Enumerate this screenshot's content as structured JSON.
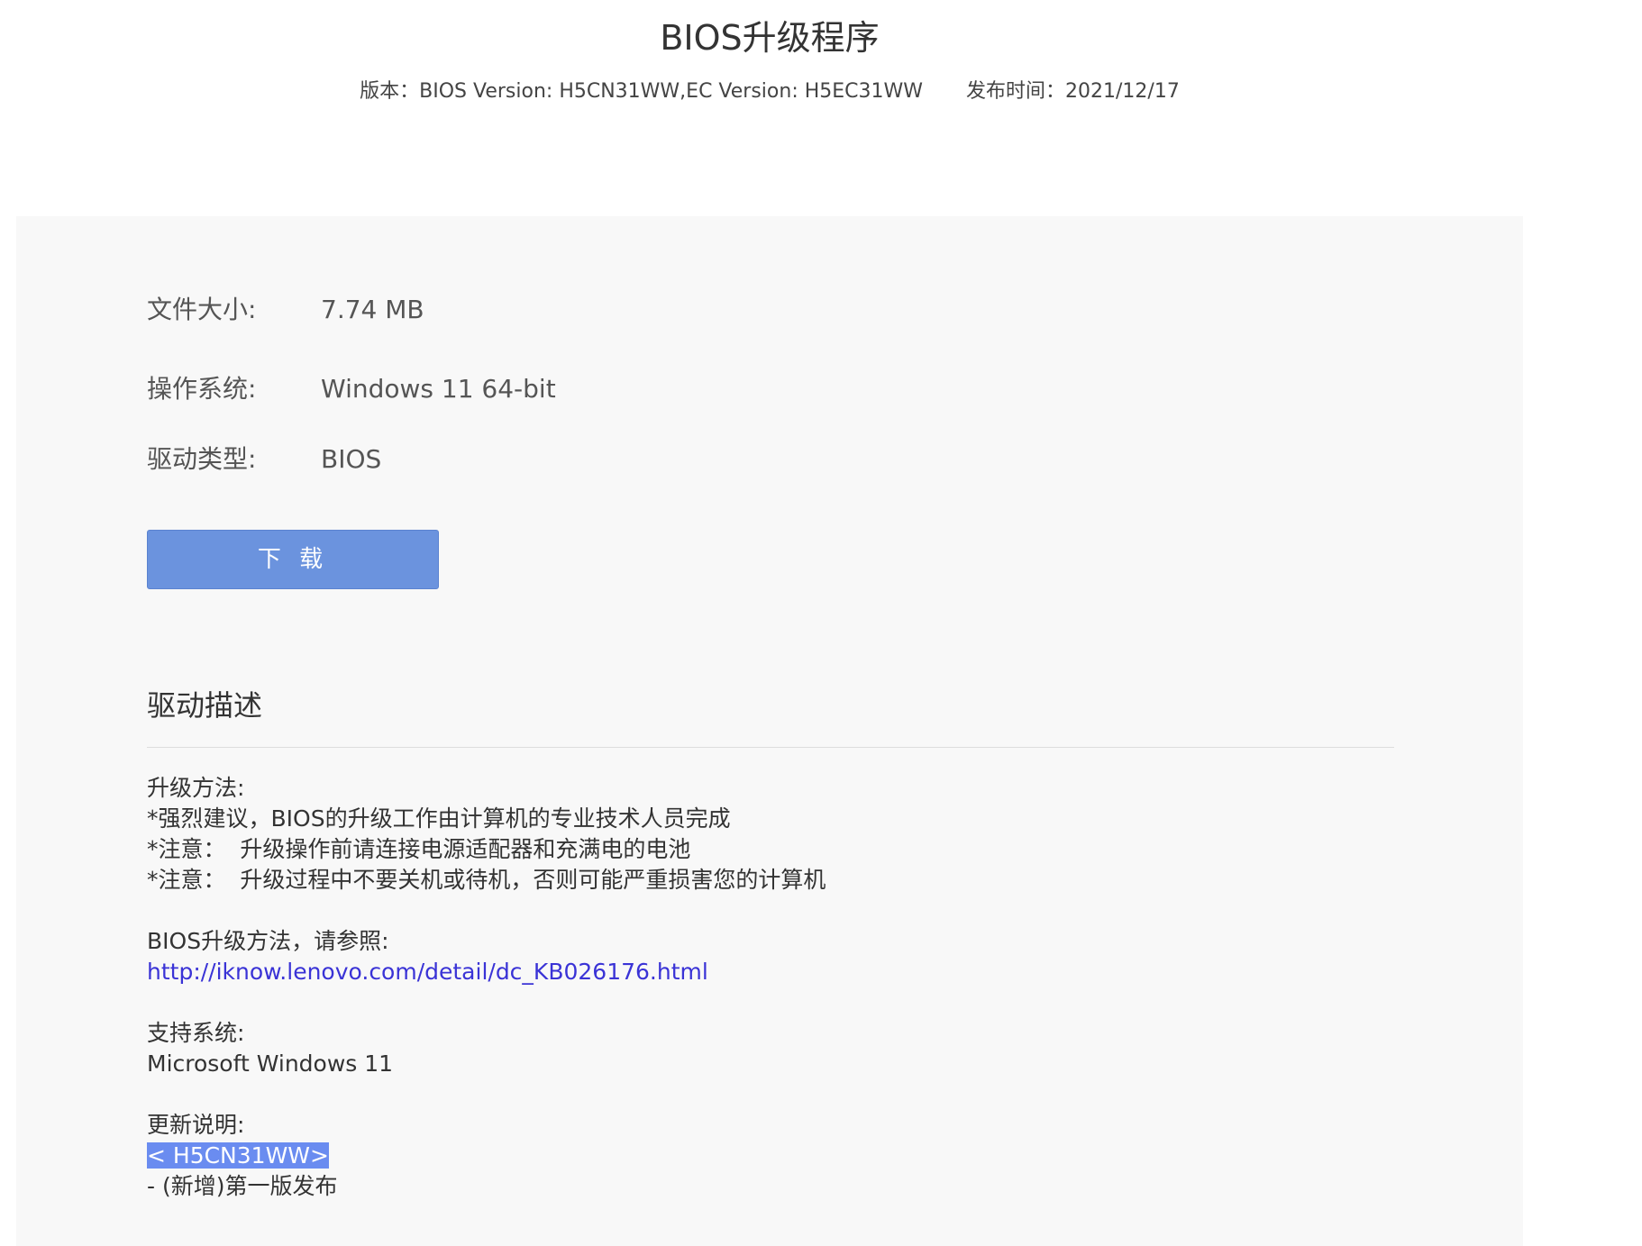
{
  "header": {
    "title": "BIOS升级程序",
    "version_text": "版本：BIOS Version: H5CN31WW,EC Version: H5EC31WW",
    "release_text": "发布时间：2021/12/17"
  },
  "info": {
    "file_size": {
      "label": "文件大小:",
      "value": "7.74 MB"
    },
    "os": {
      "label": "操作系统:",
      "value": "Windows 11 64-bit"
    },
    "driver_type": {
      "label": "驱动类型:",
      "value": "BIOS"
    }
  },
  "download_label": "下 载",
  "description": {
    "title": "驱动描述",
    "upgrade_heading": "升级方法:",
    "notes": [
      "*强烈建议，BIOS的升级工作由计算机的专业技术人员完成",
      "*注意：  升级操作前请连接电源适配器和充满电的电池",
      "*注意：  升级过程中不要关机或待机，否则可能严重损害您的计算机"
    ],
    "reference_heading": "BIOS升级方法，请参照:",
    "reference_link": "http://iknow.lenovo.com/detail/dc_KB026176.html",
    "support_heading": "支持系统:",
    "support_value": "Microsoft Windows 11",
    "update_heading": "更新说明:",
    "update_version": "< H5CN31WW>",
    "update_item": "- (新增)第一版发布"
  }
}
